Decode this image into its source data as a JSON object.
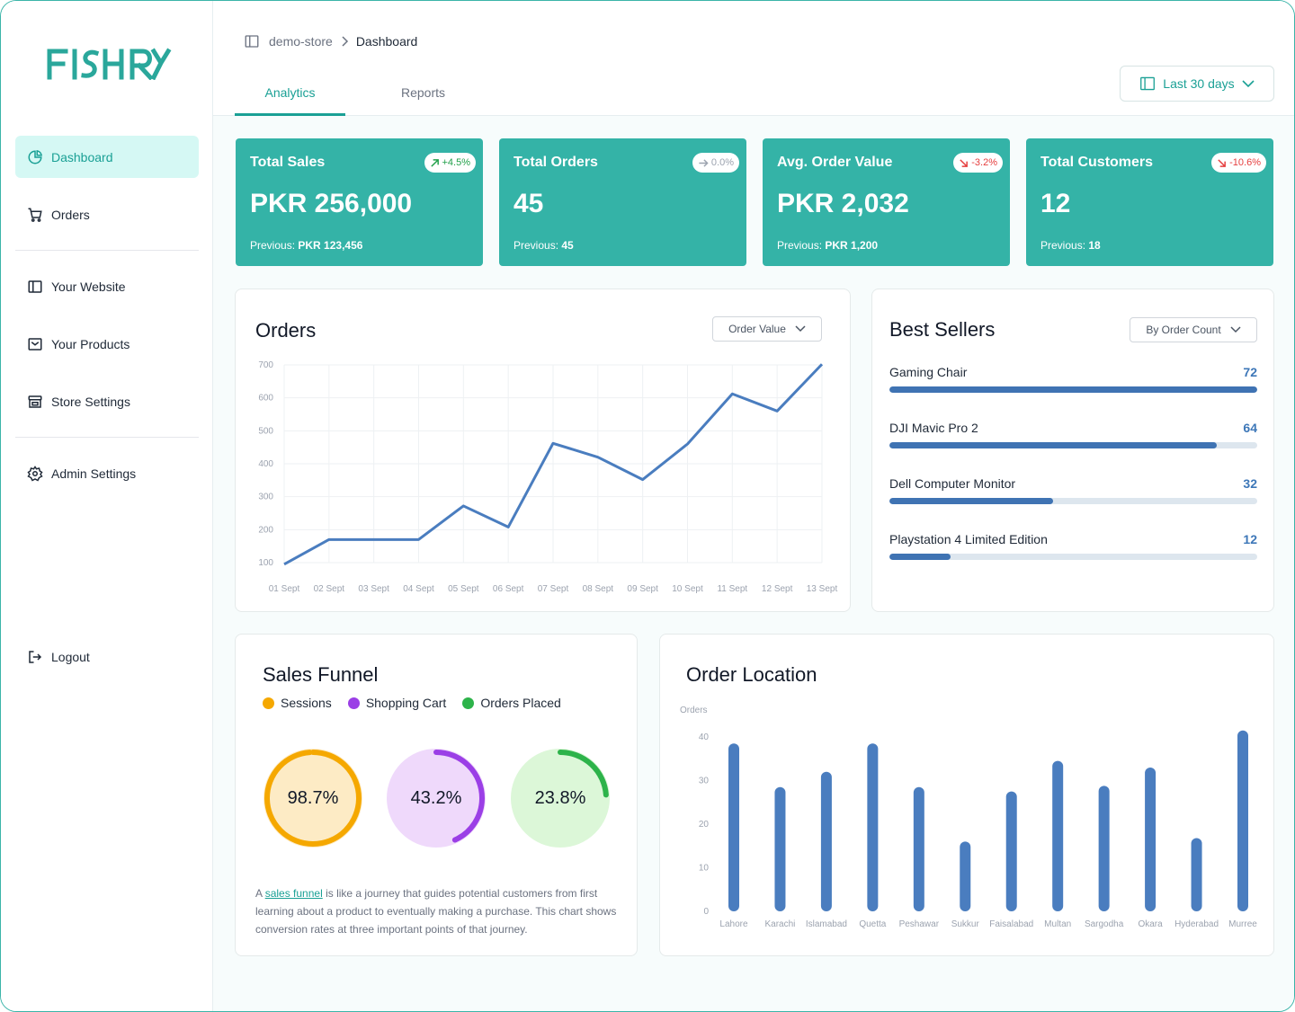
{
  "brand": {
    "name": "FISHRY",
    "color": "#2aa79b"
  },
  "sidebar": {
    "items": [
      {
        "label": "Dashboard",
        "icon": "pie-chart-icon",
        "active": true
      },
      {
        "label": "Orders",
        "icon": "cart-icon"
      },
      {
        "label": "Your Website",
        "icon": "layout-icon"
      },
      {
        "label": "Your Products",
        "icon": "inbox-icon"
      },
      {
        "label": "Store Settings",
        "icon": "store-icon"
      },
      {
        "label": "Admin Settings",
        "icon": "gear-icon"
      }
    ],
    "logout": "Logout"
  },
  "header": {
    "breadcrumb": {
      "store": "demo-store",
      "page": "Dashboard"
    },
    "tabs": [
      {
        "label": "Analytics",
        "active": true
      },
      {
        "label": "Reports"
      }
    ],
    "range": "Last 30 days"
  },
  "stats": [
    {
      "title": "Total Sales",
      "value": "PKR 256,000",
      "prev_label": "Previous:",
      "prev_value": "PKR 123,456",
      "change": "+4.5%",
      "trend": "up"
    },
    {
      "title": "Total Orders",
      "value": "45",
      "prev_label": "Previous:",
      "prev_value": "45",
      "change": "0.0%",
      "trend": "flat"
    },
    {
      "title": "Avg. Order Value",
      "value": "PKR 2,032",
      "prev_label": "Previous:",
      "prev_value": "PKR 1,200",
      "change": "-3.2%",
      "trend": "down"
    },
    {
      "title": "Total Customers",
      "value": "12",
      "prev_label": "Previous:",
      "prev_value": "18",
      "change": "-10.6%",
      "trend": "down"
    }
  ],
  "orders_card": {
    "title": "Orders",
    "dropdown": "Order Value"
  },
  "best_sellers": {
    "title": "Best Sellers",
    "dropdown": "By Order Count",
    "max": 72,
    "items": [
      {
        "name": "Gaming Chair",
        "count": 72
      },
      {
        "name": "DJI Mavic Pro 2",
        "count": 64
      },
      {
        "name": "Dell Computer Monitor",
        "count": 32
      },
      {
        "name": "Playstation 4 Limited Edition",
        "count": 12
      }
    ]
  },
  "funnel": {
    "title": "Sales Funnel",
    "legend": [
      {
        "label": "Sessions",
        "color": "#f5a800"
      },
      {
        "label": "Shopping Cart",
        "color": "#9b3fe6"
      },
      {
        "label": "Orders Placed",
        "color": "#2db34a"
      }
    ],
    "rates": [
      {
        "label": "98.7%",
        "value": 0.987,
        "color": "#f5a800",
        "bg": "#fdebc5"
      },
      {
        "label": "43.2%",
        "value": 0.432,
        "color": "#9b3fe6",
        "bg": "#efd9fb"
      },
      {
        "label": "23.8%",
        "value": 0.238,
        "color": "#2db34a",
        "bg": "#dcf7d8"
      }
    ],
    "desc_before": "A ",
    "desc_link": "sales funnel",
    "desc_after": " is like a journey that guides potential customers from first learning about a product to eventually making a purchase. This chart shows conversion rates at three important points of that journey."
  },
  "location_card": {
    "title": "Order Location"
  },
  "chart_data": [
    {
      "type": "line",
      "categories": [
        "01 Sept",
        "02 Sept",
        "03 Sept",
        "04 Sept",
        "05 Sept",
        "06 Sept",
        "07 Sept",
        "08 Sept",
        "09 Sept",
        "10 Sept",
        "11 Sept",
        "12 Sept",
        "13 Sept"
      ],
      "values": [
        95,
        170,
        170,
        170,
        272,
        208,
        462,
        420,
        352,
        460,
        612,
        560,
        702
      ],
      "ylim": [
        100,
        700
      ],
      "yticks": [
        100,
        200,
        300,
        400,
        500,
        600,
        700
      ],
      "grid": true,
      "color": "#4a7dbf"
    },
    {
      "type": "bar",
      "ylabel": "Orders",
      "categories": [
        "Lahore",
        "Karachi",
        "Islamabad",
        "Quetta",
        "Peshawar",
        "Sukkur",
        "Faisalabad",
        "Multan",
        "Sargodha",
        "Okara",
        "Hyderabad",
        "Murree"
      ],
      "values": [
        38.5,
        28.5,
        32,
        38.5,
        28.5,
        16,
        27.5,
        34.5,
        28.8,
        33,
        16.8,
        41.5
      ],
      "ylim": [
        0,
        40
      ],
      "yticks": [
        0,
        10,
        20,
        30,
        40
      ],
      "color": "#4a7dbf"
    }
  ]
}
